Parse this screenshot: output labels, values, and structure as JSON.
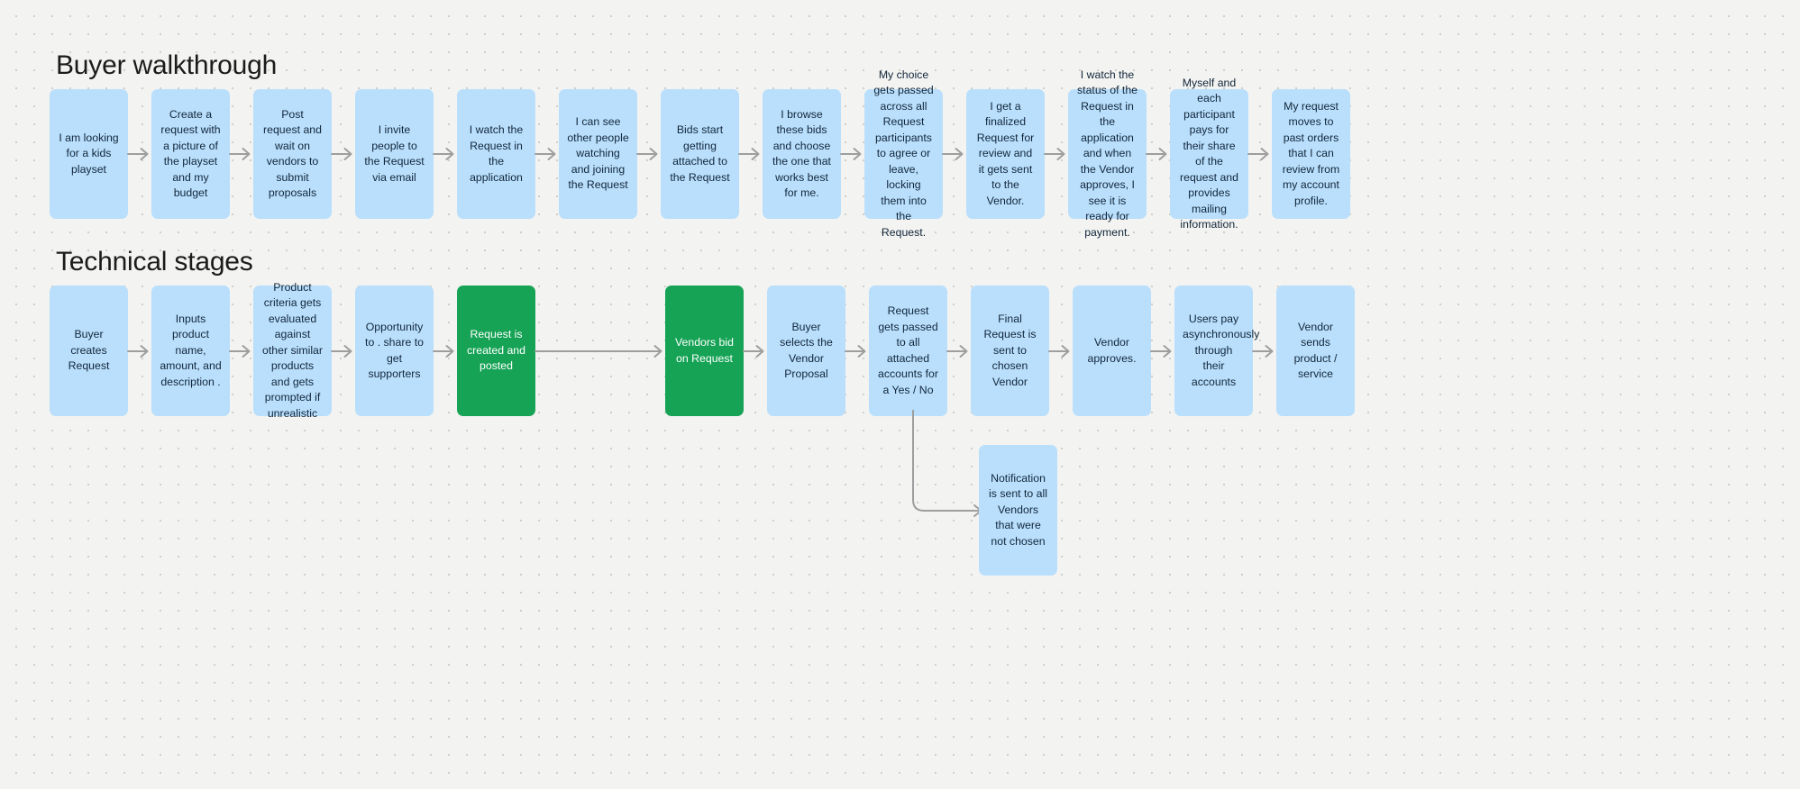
{
  "canvas": {
    "background_color": "#f3f3f1",
    "dot_color": "#cfcfc9",
    "card_blue": "#b9dffc",
    "card_green": "#16a355",
    "arrow_color": "#9e9e9e",
    "text_color": "#12263a"
  },
  "sections": [
    {
      "id": "buyer",
      "title": "Buyer walkthrough",
      "cards": [
        {
          "text": "I am looking for a kids playset",
          "color": "blue"
        },
        {
          "text": "Create a request with a picture of the playset and my budget",
          "color": "blue"
        },
        {
          "text": "Post request and wait on vendors to submit proposals",
          "color": "blue"
        },
        {
          "text": "I invite people to the Request via email",
          "color": "blue"
        },
        {
          "text": "I watch the Request in the application",
          "color": "blue"
        },
        {
          "text": "I can see other people watching and joining the Request",
          "color": "blue"
        },
        {
          "text": "Bids start getting attached to the Request",
          "color": "blue"
        },
        {
          "text": "I browse these bids and choose the one that works best for me.",
          "color": "blue"
        },
        {
          "text": "My choice gets passed across all Request participants to agree or leave, locking them into the Request.",
          "color": "blue"
        },
        {
          "text": "I get a finalized Request for review and it gets sent to the Vendor.",
          "color": "blue"
        },
        {
          "text": "I watch the status of the Request in the application and when the Vendor approves, I see it is ready for payment.",
          "color": "blue"
        },
        {
          "text": "Myself and each participant pays for their share of the request and provides mailing information.",
          "color": "blue"
        },
        {
          "text": "My request moves to past orders that I can review from my account profile.",
          "color": "blue"
        }
      ]
    },
    {
      "id": "technical",
      "title": "Technical stages",
      "cards": [
        {
          "text": "Buyer creates Request",
          "color": "blue"
        },
        {
          "text": "Inputs product name, amount, and description .",
          "color": "blue"
        },
        {
          "text": "Product criteria gets evaluated against other similar products and gets prompted if unrealistic",
          "color": "blue"
        },
        {
          "text": "Opportunity to . share to get supporters",
          "color": "blue"
        },
        {
          "text": "Request is created and posted",
          "color": "green"
        },
        {
          "text": "Vendors bid on Request",
          "color": "green"
        },
        {
          "text": "Buyer selects the Vendor Proposal",
          "color": "blue"
        },
        {
          "text": "Request gets passed to all attached accounts for a Yes / No",
          "color": "blue"
        },
        {
          "text": "Final Request is sent to chosen Vendor",
          "color": "blue"
        },
        {
          "text": "Vendor approves.",
          "color": "blue"
        },
        {
          "text": "Users pay asynchronously through their accounts",
          "color": "blue"
        },
        {
          "text": "Vendor sends product / service",
          "color": "blue"
        }
      ]
    }
  ],
  "branch": {
    "from_card": "Request gets passed to all attached accounts for a Yes / No",
    "notification_card": {
      "text": "Notification is sent to all Vendors that were not chosen",
      "color": "blue"
    }
  },
  "icons": {
    "arrow": "arrow-right-icon",
    "elbow": "elbow-arrow-icon"
  }
}
